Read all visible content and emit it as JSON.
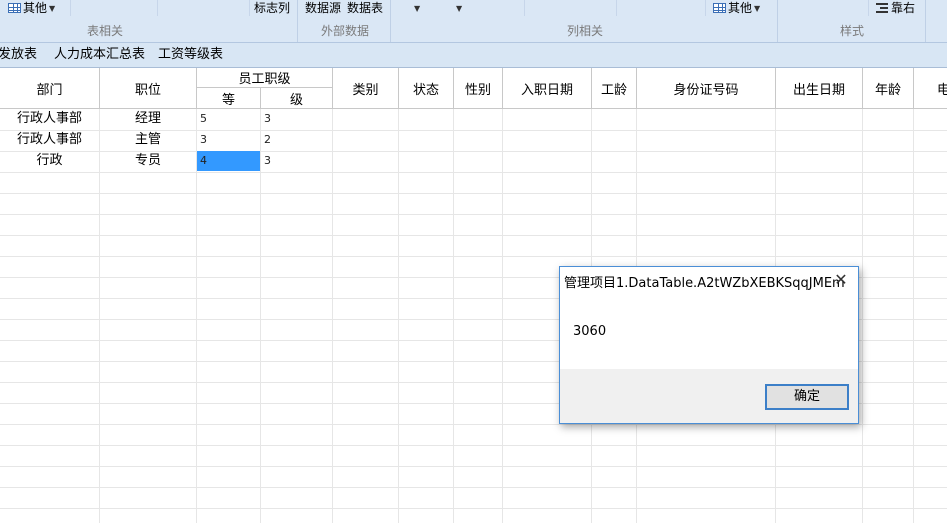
{
  "ribbon": {
    "other_left": "其他",
    "flag_col": "标志列",
    "data_source": "数据源",
    "data_table": "数据表",
    "other_right": "其他",
    "align_right": "靠右",
    "group_table": "表相关",
    "group_external": "外部数据",
    "group_column": "列相关",
    "group_style": "样式"
  },
  "sheet_tabs": [
    "发放表",
    "人力成本汇总表",
    "工资等级表"
  ],
  "grid": {
    "headers": {
      "dept": "部门",
      "position": "职位",
      "level_group": "员工职级",
      "level_grade": "等",
      "level_class": "级",
      "category": "类别",
      "status": "状态",
      "gender": "性别",
      "hire_date": "入职日期",
      "seniority": "工龄",
      "id_number": "身份证号码",
      "birth_date": "出生日期",
      "age": "年龄",
      "more": "电"
    },
    "rows": [
      {
        "dept": "行政人事部",
        "position": "经理",
        "grade": "5",
        "cls": "3"
      },
      {
        "dept": "行政人事部",
        "position": "主管",
        "grade": "3",
        "cls": "2"
      },
      {
        "dept": "行政",
        "position": "专员",
        "grade": "4",
        "cls": "3"
      }
    ]
  },
  "dialog": {
    "title": "管理项目1.DataTable.A2tWZbXEBKSqqJMEm",
    "message": "3060",
    "ok_label": "确定",
    "close_glyph": "✕"
  },
  "colors": {
    "ribbon_bg": "#dae7f5",
    "selection": "#3399ff",
    "dialog_border": "#4a8ed6"
  }
}
